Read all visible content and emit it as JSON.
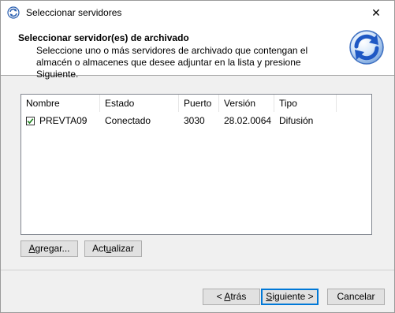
{
  "window": {
    "title": "Seleccionar servidores",
    "close_glyph": "✕"
  },
  "header": {
    "title": "Seleccionar servidor(es) de archivado",
    "description": "Seleccione uno o más servidores de archivado que contengan el almacén o almacenes que desee adjuntar en la lista y presione Siguiente.",
    "icon": "refresh-icon"
  },
  "list": {
    "columns": [
      "Nombre",
      "Estado",
      "Puerto",
      "Versión",
      "Tipo"
    ],
    "rows": [
      {
        "checked": true,
        "nombre": "PREVTA09",
        "estado": "Conectado",
        "puerto": "3030",
        "version": "28.02.0064",
        "tipo": "Difusión"
      }
    ]
  },
  "buttons": {
    "agregar": {
      "prefix": "",
      "accel": "A",
      "rest": "gregar..."
    },
    "actualizar": {
      "prefix": "Act",
      "accel": "u",
      "rest": "alizar"
    },
    "atras": {
      "prefix": "< ",
      "accel": "A",
      "rest": "trás"
    },
    "siguiente": {
      "prefix": "",
      "accel": "S",
      "rest": "iguiente >"
    },
    "cancelar": {
      "prefix": "",
      "accel": "",
      "rest": "Cancelar"
    }
  },
  "colors": {
    "accent": "#0078d7",
    "checkbox_check": "#1a7f1a"
  }
}
